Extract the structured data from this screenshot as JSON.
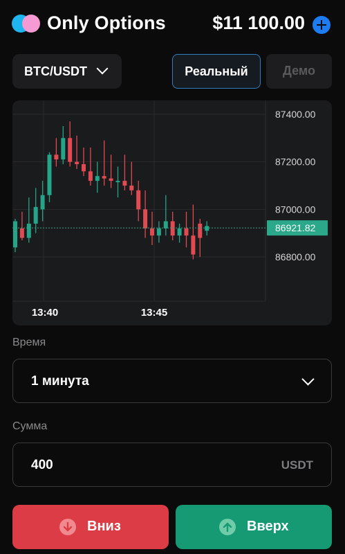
{
  "header": {
    "title": "Only Options",
    "balance": "$11 100.00",
    "add_funds_icon": "plus-circle-icon",
    "colors": {
      "logo_left": "#1fb6f0",
      "logo_right": "#f59ad3",
      "add_button": "#1d7cf2"
    }
  },
  "pair_selector": {
    "value": "BTC/USDT",
    "icon": "chevron-down-icon"
  },
  "mode": {
    "real_label": "Реальный",
    "demo_label": "Демо",
    "selected": "real"
  },
  "chart_data": {
    "type": "candlestick",
    "y_ticks": [
      "87400.00",
      "87200.00",
      "87000.00",
      "86800.00"
    ],
    "x_ticks": [
      "13:40",
      "13:45"
    ],
    "current_price": "86921.82",
    "ylim": [
      86700,
      87450
    ],
    "grid": true,
    "colors": {
      "up": "#26a48a",
      "down": "#e04a52",
      "current_price_tag": "#2aa889"
    },
    "candles": [
      {
        "o": 86840,
        "h": 86960,
        "l": 86820,
        "c": 86950
      },
      {
        "o": 86920,
        "h": 86990,
        "l": 86870,
        "c": 86880
      },
      {
        "o": 86880,
        "h": 87050,
        "l": 86860,
        "c": 86940
      },
      {
        "o": 86940,
        "h": 87090,
        "l": 86900,
        "c": 87010
      },
      {
        "o": 87000,
        "h": 87120,
        "l": 86950,
        "c": 87060
      },
      {
        "o": 87060,
        "h": 87240,
        "l": 87030,
        "c": 87230
      },
      {
        "o": 87230,
        "h": 87300,
        "l": 87180,
        "c": 87210
      },
      {
        "o": 87210,
        "h": 87350,
        "l": 87190,
        "c": 87300
      },
      {
        "o": 87300,
        "h": 87370,
        "l": 87180,
        "c": 87200
      },
      {
        "o": 87200,
        "h": 87310,
        "l": 87170,
        "c": 87190
      },
      {
        "o": 87190,
        "h": 87260,
        "l": 87140,
        "c": 87160
      },
      {
        "o": 87160,
        "h": 87260,
        "l": 87100,
        "c": 87120
      },
      {
        "o": 87120,
        "h": 87200,
        "l": 87070,
        "c": 87140
      },
      {
        "o": 87140,
        "h": 87290,
        "l": 87100,
        "c": 87130
      },
      {
        "o": 87130,
        "h": 87230,
        "l": 87090,
        "c": 87120
      },
      {
        "o": 87120,
        "h": 87180,
        "l": 87050,
        "c": 87120
      },
      {
        "o": 87120,
        "h": 87230,
        "l": 87080,
        "c": 87100
      },
      {
        "o": 87100,
        "h": 87200,
        "l": 87060,
        "c": 87080
      },
      {
        "o": 87080,
        "h": 87120,
        "l": 86950,
        "c": 87000
      },
      {
        "o": 87000,
        "h": 87080,
        "l": 86880,
        "c": 86920
      },
      {
        "o": 86920,
        "h": 86990,
        "l": 86850,
        "c": 86890
      },
      {
        "o": 86890,
        "h": 86950,
        "l": 86860,
        "c": 86920
      },
      {
        "o": 86920,
        "h": 87060,
        "l": 86890,
        "c": 86950
      },
      {
        "o": 86950,
        "h": 86990,
        "l": 86870,
        "c": 86890
      },
      {
        "o": 86890,
        "h": 86940,
        "l": 86860,
        "c": 86920
      },
      {
        "o": 86920,
        "h": 86990,
        "l": 86840,
        "c": 86890
      },
      {
        "o": 86890,
        "h": 87020,
        "l": 86790,
        "c": 86810
      },
      {
        "o": 86940,
        "h": 86960,
        "l": 86800,
        "c": 86880
      },
      {
        "o": 86910,
        "h": 86950,
        "l": 86890,
        "c": 86930
      }
    ]
  },
  "time": {
    "label": "Время",
    "value": "1 минута",
    "icon": "chevron-down-icon"
  },
  "amount": {
    "label": "Сумма",
    "value": "400",
    "unit": "USDT"
  },
  "actions": {
    "down_label": "Вниз",
    "down_icon": "arrow-down-circle-icon",
    "down_color": "#dc3c45",
    "up_label": "Вверх",
    "up_icon": "arrow-up-circle-icon",
    "up_color": "#169a74"
  }
}
